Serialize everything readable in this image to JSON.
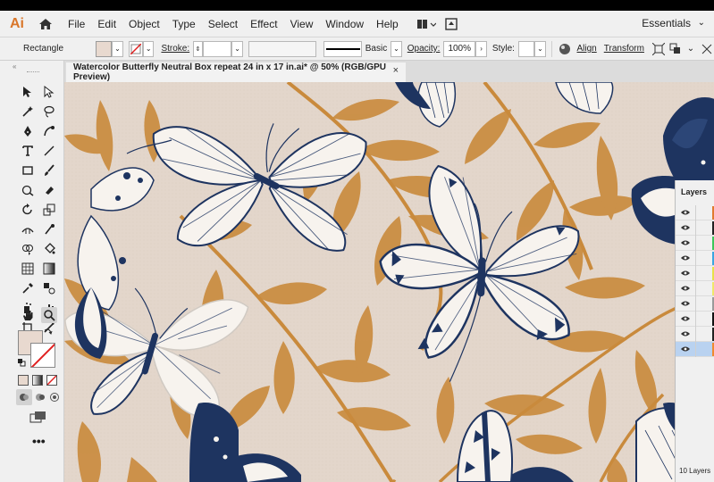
{
  "menu": {
    "app_logo": "Ai",
    "items": [
      "File",
      "Edit",
      "Object",
      "Type",
      "Select",
      "Effect",
      "View",
      "Window",
      "Help"
    ],
    "workspace": "Essentials"
  },
  "control_bar": {
    "selection_type": "Rectangle",
    "stroke_label": "Stroke:",
    "brush_label": "Basic",
    "opacity_label": "Opacity:",
    "opacity_value": "100%",
    "style_label": "Style:",
    "align_label": "Align",
    "transform_label": "Transform",
    "fill_color": "#e8d9cf"
  },
  "document": {
    "tab_title": "Watercolor Butterfly Neutral Box repeat 24 in x 17 in.ai* @ 50% (RGB/GPU Preview)",
    "close_glyph": "×"
  },
  "colors": {
    "canvas_bg": "#e3d6cb",
    "leaf": "#c98a3c",
    "navy": "#1e3460",
    "wing": "#f7f3ee"
  },
  "layers": {
    "title": "Layers",
    "count_label": "10 Layers",
    "rows": [
      {
        "color": "#e07a30"
      },
      {
        "color": "#222222"
      },
      {
        "color": "#3cc65a"
      },
      {
        "color": "#3aa6e0"
      },
      {
        "color": "#e8e04a"
      },
      {
        "color": "#f0e76a"
      },
      {
        "color": "#9a9a9a"
      },
      {
        "color": "#111111"
      },
      {
        "color": "#222222"
      },
      {
        "color": "#f08a30"
      }
    ],
    "selected_index": 9
  }
}
